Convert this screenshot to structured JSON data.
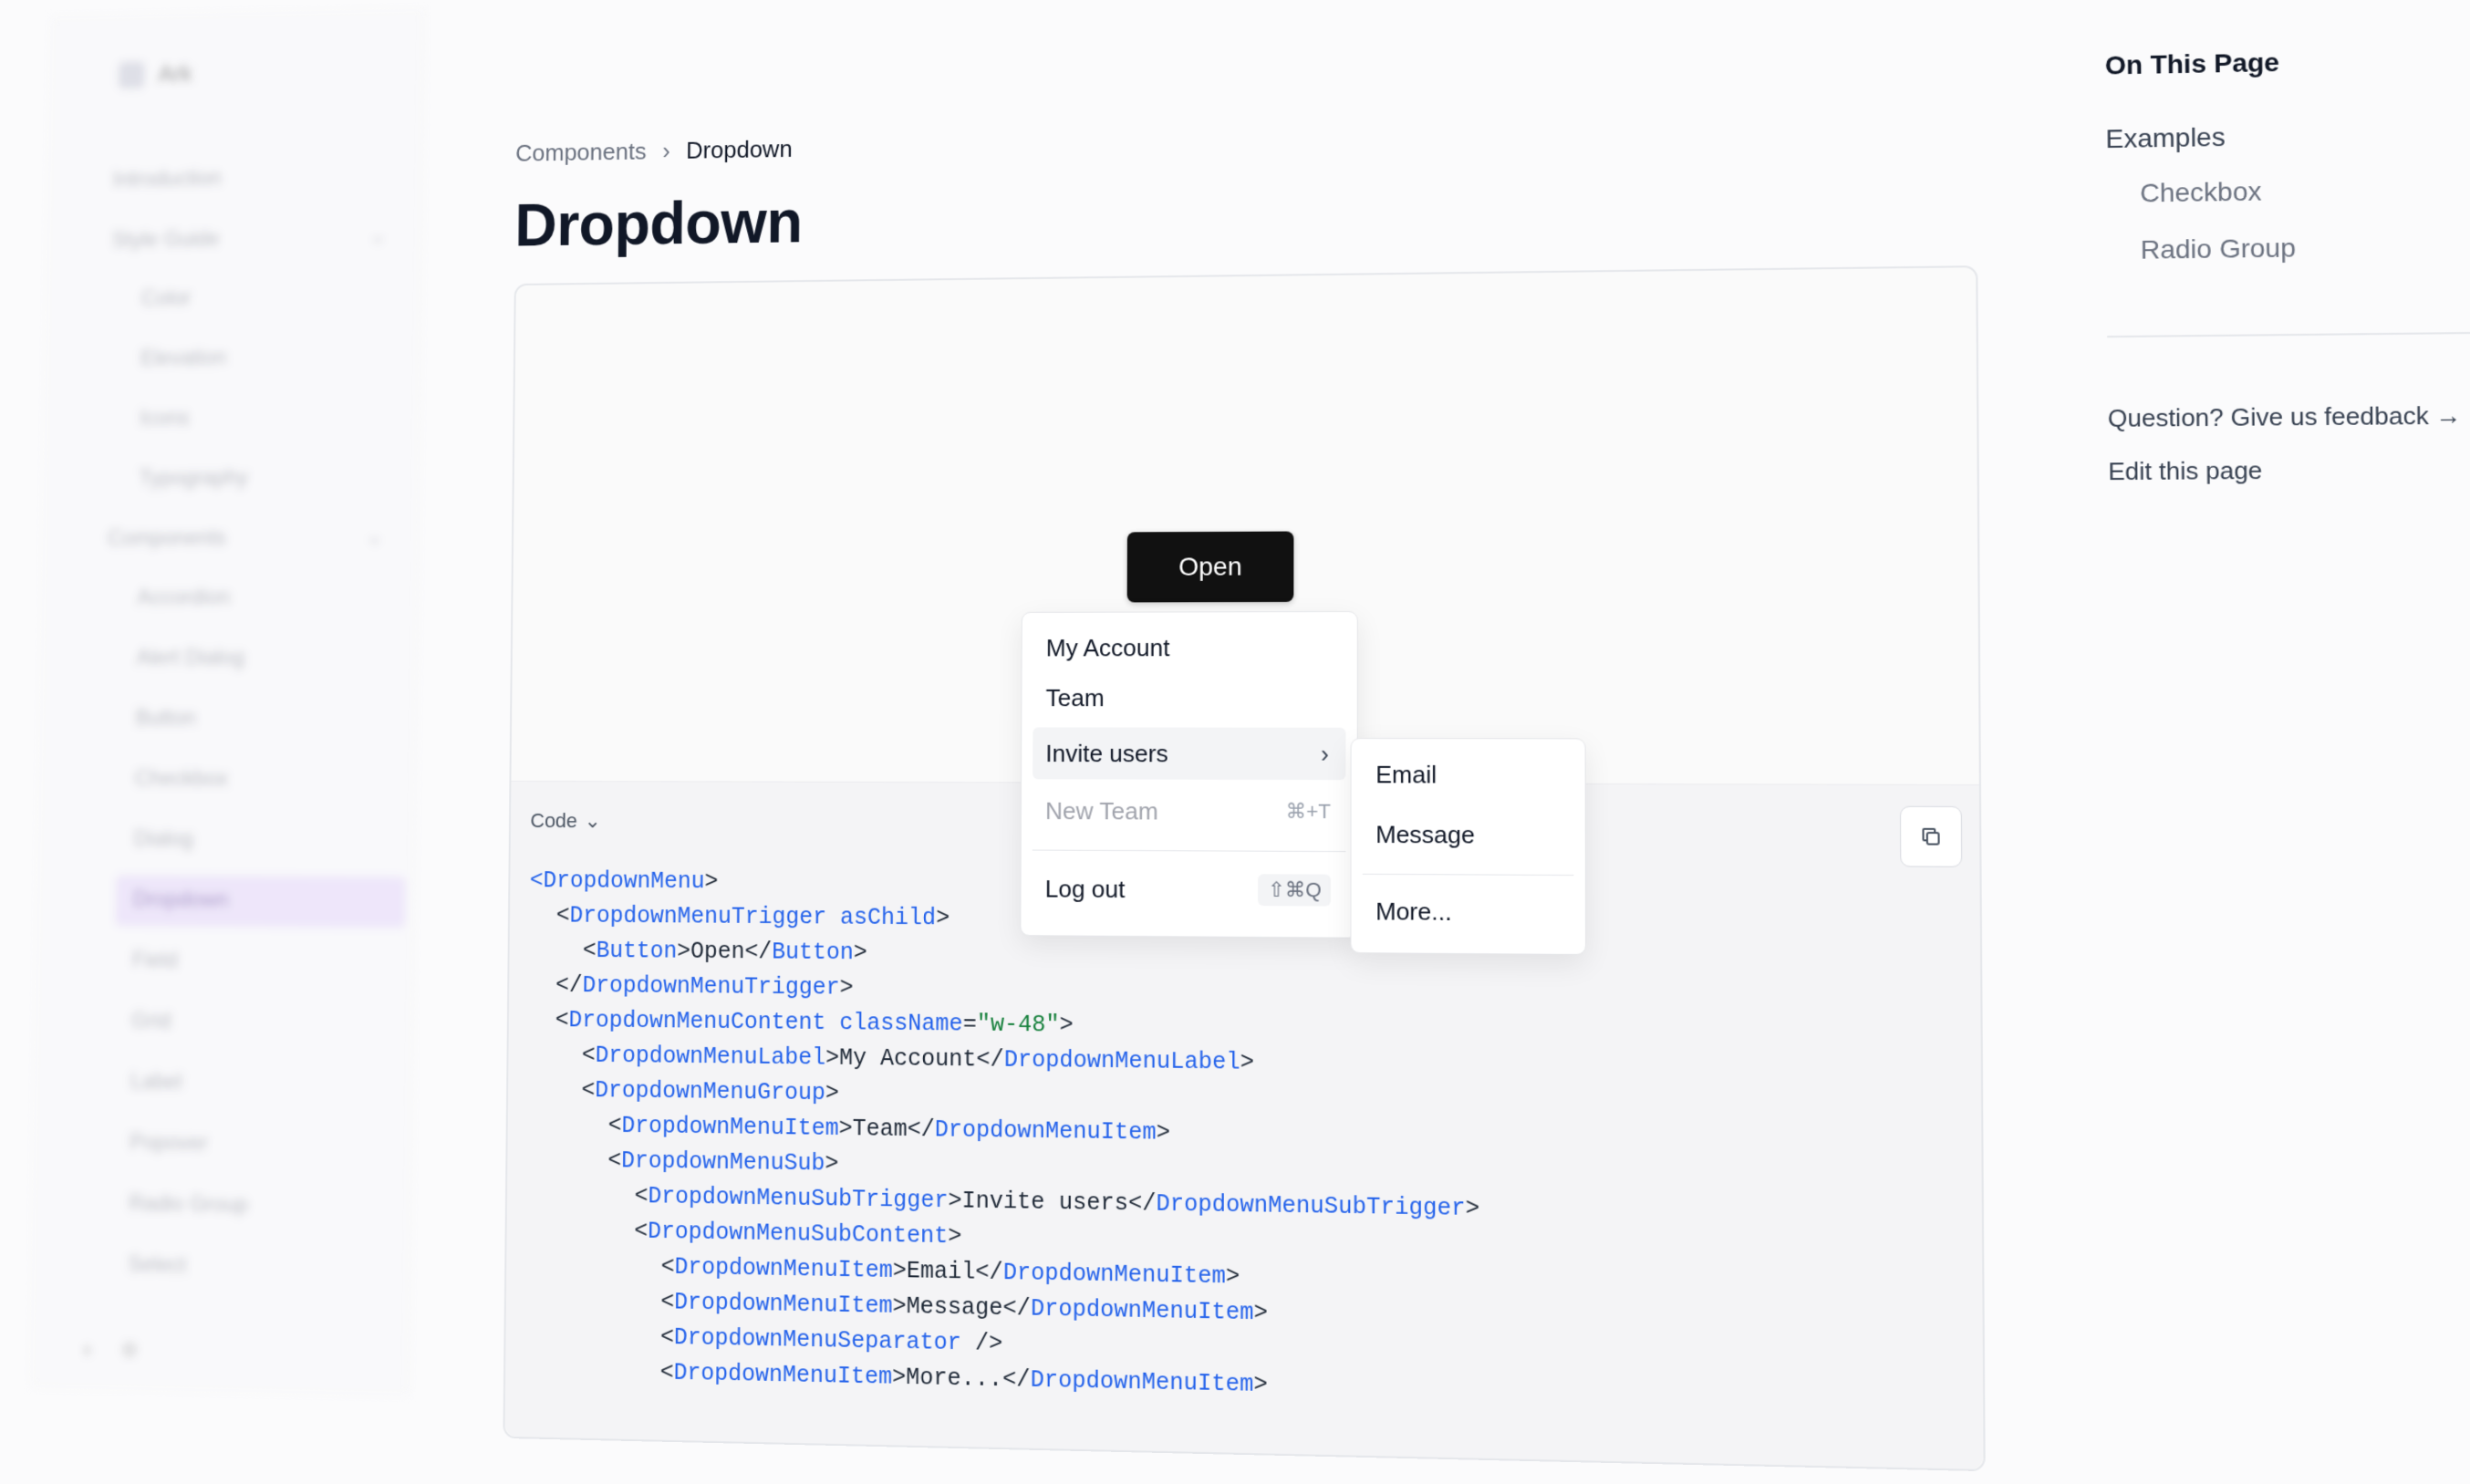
{
  "sidebar": {
    "logo_text": "Ark",
    "groups": [
      {
        "label": "Introduction",
        "has_children": false
      },
      {
        "label": "Style Guide",
        "has_children": true,
        "items": [
          "Color",
          "Elevation",
          "Icons",
          "Typography"
        ]
      },
      {
        "label": "Components",
        "has_children": true,
        "items": [
          "Accordion",
          "Alert Dialog",
          "Button",
          "Checkbox",
          "Dialog",
          "Dropdown",
          "Field",
          "Grid",
          "Label",
          "Popover",
          "Radio Group",
          "Select"
        ]
      }
    ],
    "active_item": "Dropdown",
    "footer": [
      "",
      ""
    ]
  },
  "breadcrumb": {
    "parent": "Components",
    "separator": "›",
    "current": "Dropdown"
  },
  "page_title": "Dropdown",
  "preview": {
    "trigger_label": "Open",
    "menu": {
      "label": "My Account",
      "team": "Team",
      "invite": "Invite users",
      "new_team": "New Team",
      "new_team_shortcut": "⌘+T",
      "logout": "Log out",
      "logout_shortcut": "⇧⌘Q"
    },
    "submenu": {
      "email": "Email",
      "message": "Message",
      "more": "More..."
    }
  },
  "code_panel": {
    "toggle_label": "Code",
    "lines": [
      {
        "indent": "",
        "parts": [
          [
            "tag",
            "<"
          ],
          [
            "tag",
            "DropdownMenu"
          ],
          [
            "txt",
            ">"
          ]
        ]
      },
      {
        "indent": "  ",
        "parts": [
          [
            "txt",
            "<"
          ],
          [
            "tag",
            "DropdownMenuTrigger"
          ],
          [
            "txt",
            " "
          ],
          [
            "attr",
            "asChild"
          ],
          [
            "txt",
            ">"
          ]
        ]
      },
      {
        "indent": "    ",
        "parts": [
          [
            "txt",
            "<"
          ],
          [
            "tag",
            "Button"
          ],
          [
            "txt",
            ">Open</"
          ],
          [
            "tag",
            "Button"
          ],
          [
            "txt",
            ">"
          ]
        ]
      },
      {
        "indent": "  ",
        "parts": [
          [
            "txt",
            "</"
          ],
          [
            "tag",
            "DropdownMenuTrigger"
          ],
          [
            "txt",
            ">"
          ]
        ]
      },
      {
        "indent": "  ",
        "parts": [
          [
            "txt",
            "<"
          ],
          [
            "tag",
            "DropdownMenuContent"
          ],
          [
            "txt",
            " "
          ],
          [
            "attr",
            "className"
          ],
          [
            "txt",
            "="
          ],
          [
            "str",
            "\"w-48\""
          ],
          [
            "txt",
            ">"
          ]
        ]
      },
      {
        "indent": "    ",
        "parts": [
          [
            "txt",
            "<"
          ],
          [
            "tag",
            "DropdownMenuLabel"
          ],
          [
            "txt",
            ">My Account</"
          ],
          [
            "tag",
            "DropdownMenuLabel"
          ],
          [
            "txt",
            ">"
          ]
        ]
      },
      {
        "indent": "    ",
        "parts": [
          [
            "txt",
            "<"
          ],
          [
            "tag",
            "DropdownMenuGroup"
          ],
          [
            "txt",
            ">"
          ]
        ]
      },
      {
        "indent": "      ",
        "parts": [
          [
            "txt",
            "<"
          ],
          [
            "tag",
            "DropdownMenuItem"
          ],
          [
            "txt",
            ">Team</"
          ],
          [
            "tag",
            "DropdownMenuItem"
          ],
          [
            "txt",
            ">"
          ]
        ]
      },
      {
        "indent": "      ",
        "parts": [
          [
            "txt",
            "<"
          ],
          [
            "tag",
            "DropdownMenuSub"
          ],
          [
            "txt",
            ">"
          ]
        ]
      },
      {
        "indent": "        ",
        "parts": [
          [
            "txt",
            "<"
          ],
          [
            "tag",
            "DropdownMenuSubTrigger"
          ],
          [
            "txt",
            ">Invite users</"
          ],
          [
            "tag",
            "DropdownMenuSubTrigger"
          ],
          [
            "txt",
            ">"
          ]
        ]
      },
      {
        "indent": "        ",
        "parts": [
          [
            "txt",
            "<"
          ],
          [
            "tag",
            "DropdownMenuSubContent"
          ],
          [
            "txt",
            ">"
          ]
        ]
      },
      {
        "indent": "          ",
        "parts": [
          [
            "txt",
            "<"
          ],
          [
            "tag",
            "DropdownMenuItem"
          ],
          [
            "txt",
            ">Email</"
          ],
          [
            "tag",
            "DropdownMenuItem"
          ],
          [
            "txt",
            ">"
          ]
        ]
      },
      {
        "indent": "          ",
        "parts": [
          [
            "txt",
            "<"
          ],
          [
            "tag",
            "DropdownMenuItem"
          ],
          [
            "txt",
            ">Message</"
          ],
          [
            "tag",
            "DropdownMenuItem"
          ],
          [
            "txt",
            ">"
          ]
        ]
      },
      {
        "indent": "          ",
        "parts": [
          [
            "txt",
            "<"
          ],
          [
            "tag",
            "DropdownMenuSeparator"
          ],
          [
            "txt",
            " />"
          ]
        ]
      },
      {
        "indent": "          ",
        "parts": [
          [
            "txt",
            "<"
          ],
          [
            "tag",
            "DropdownMenuItem"
          ],
          [
            "txt",
            ">More...</"
          ],
          [
            "tag",
            "DropdownMenuItem"
          ],
          [
            "txt",
            ">"
          ]
        ]
      }
    ]
  },
  "toc": {
    "title": "On This Page",
    "items": [
      {
        "label": "Examples",
        "level": 0
      },
      {
        "label": "Checkbox",
        "level": 1
      },
      {
        "label": "Radio Group",
        "level": 1
      }
    ],
    "feedback": "Question? Give us feedback →",
    "edit": "Edit this page"
  },
  "colors": {
    "accent_active": "#e3d6f7",
    "button_bg": "#111111",
    "code_tag": "#2563eb",
    "code_string": "#16803c"
  },
  "icons": {
    "copy": "copy-icon",
    "chevron_down": "chevron-down-icon",
    "chevron_right": "chevron-right-icon"
  }
}
